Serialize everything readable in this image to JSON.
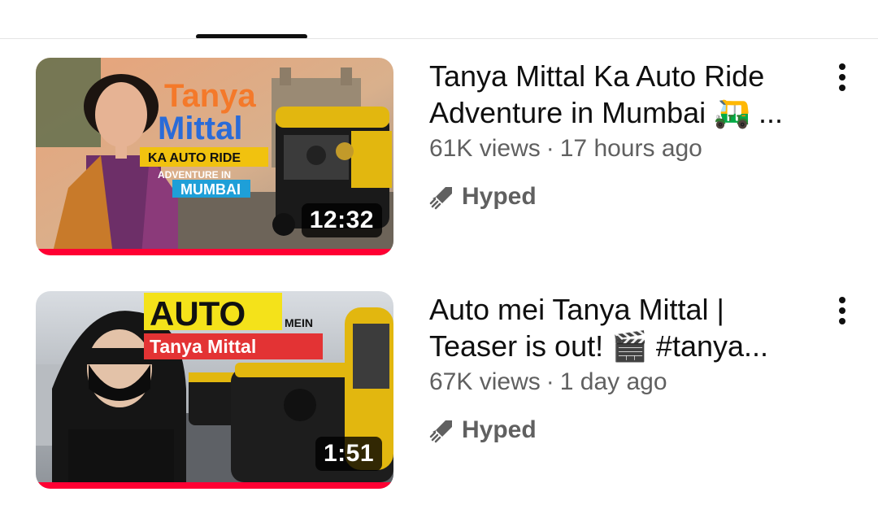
{
  "videos": [
    {
      "title": "Tanya Mittal Ka Auto Ride Adventure in Mumbai 🛺 ...",
      "views": "61K views",
      "age": "17 hours ago",
      "badge": "Hyped",
      "duration": "12:32",
      "progress": 1.0,
      "thumb_text": {
        "line1": "Tanya",
        "line2": "Mittal",
        "line3": "KA AUTO RIDE",
        "line4": "ADVENTURE IN",
        "line5": "MUMBAI"
      }
    },
    {
      "title": "Auto mei Tanya Mittal | Teaser is out! 🎬 #tanya...",
      "views": "67K views",
      "age": "1 day ago",
      "badge": "Hyped",
      "duration": "1:51",
      "progress": 1.0,
      "thumb_text": {
        "line1": "AUTO",
        "line2": "MEIN",
        "line3": "Tanya Mittal"
      }
    }
  ],
  "meta_separator": "·",
  "icons": {
    "menu": "more-vert-icon",
    "hyped": "hyped-rocket-icon"
  },
  "colors": {
    "progress": "#ff0033",
    "text_primary": "#0f0f0f",
    "text_secondary": "#606060"
  }
}
